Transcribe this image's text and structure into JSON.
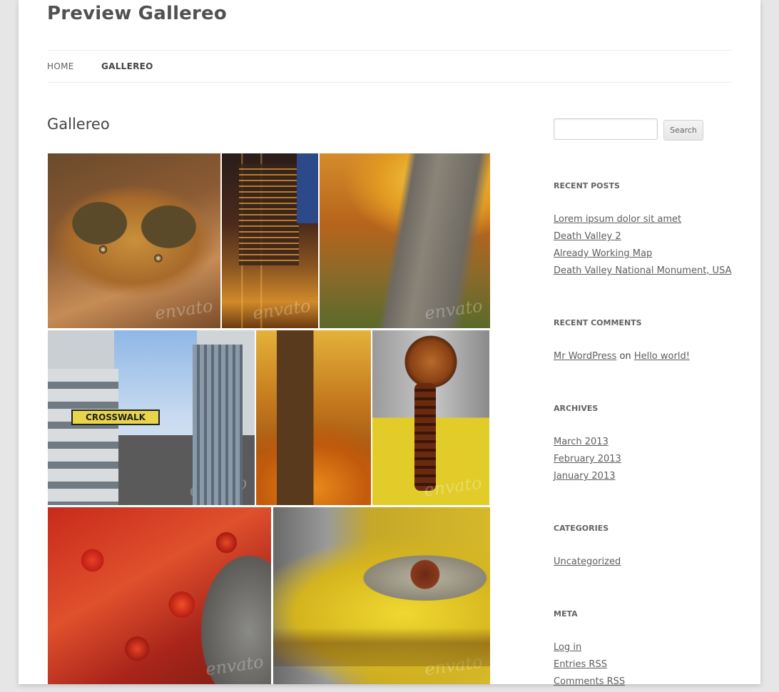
{
  "site": {
    "title": "Preview Gallereo"
  },
  "nav": {
    "items": [
      {
        "label": "HOME"
      },
      {
        "label": "GALLEREO"
      }
    ]
  },
  "page": {
    "title": "Gallereo"
  },
  "gallery": {
    "watermark": "envato",
    "tiles": [
      {
        "subject": "butterfly-on-leaves"
      },
      {
        "subject": "city-hotel-at-night"
      },
      {
        "subject": "autumn-forest-path"
      },
      {
        "subject": "crosswalk-sign-buildings",
        "sign_text": "CROSSWALK"
      },
      {
        "subject": "autumn-tree-trunk"
      },
      {
        "subject": "rusty-hydrant-chain"
      },
      {
        "subject": "red-oak-leaves"
      },
      {
        "subject": "yellow-hydrant-closeup"
      }
    ]
  },
  "sidebar": {
    "search": {
      "placeholder": "",
      "button_label": "Search"
    },
    "recent_posts": {
      "title": "RECENT POSTS",
      "items": [
        "Lorem ipsum dolor sit amet",
        "Death Valley 2",
        "Already Working Map",
        "Death Valley National Monument, USA"
      ]
    },
    "recent_comments": {
      "title": "RECENT COMMENTS",
      "author": "Mr WordPress",
      "connector": "on",
      "post": "Hello world!"
    },
    "archives": {
      "title": "ARCHIVES",
      "items": [
        "March 2013",
        "February 2013",
        "January 2013"
      ]
    },
    "categories": {
      "title": "CATEGORIES",
      "items": [
        "Uncategorized"
      ]
    },
    "meta": {
      "title": "META",
      "items": [
        "Log in",
        "Entries RSS",
        "Comments RSS"
      ]
    }
  }
}
